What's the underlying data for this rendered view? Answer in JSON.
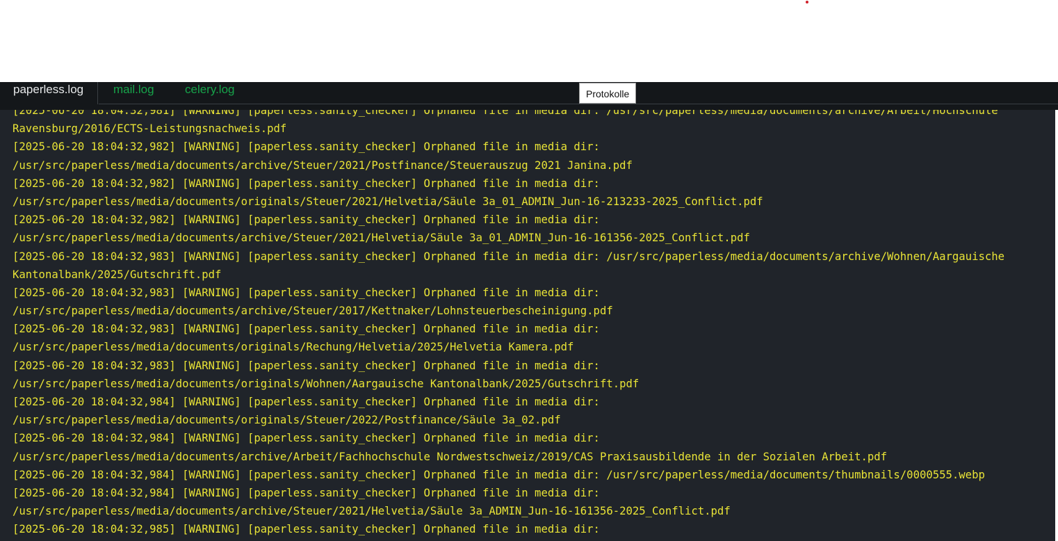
{
  "tabs": [
    {
      "label": "paperless.log",
      "active": true
    },
    {
      "label": "mail.log",
      "active": false
    },
    {
      "label": "celery.log",
      "active": false
    }
  ],
  "tooltip": "Protokolle",
  "colors": {
    "log_text": "#e8e336",
    "log_background": "#20242a",
    "tab_inactive": "#17a34a",
    "tab_bar": "#14171a"
  },
  "log_lines": [
    "[2025-06-20 18:04:32,981] [WARNING] [paperless.sanity_checker] Orphaned file in media dir: /usr/src/paperless/media/documents/archive/Arbeit/Hochschule",
    "Ravensburg/2016/ECTS-Leistungsnachweis.pdf",
    "[2025-06-20 18:04:32,982] [WARNING] [paperless.sanity_checker] Orphaned file in media dir:",
    "/usr/src/paperless/media/documents/archive/Steuer/2021/Postfinance/Steuerauszug 2021 Janina.pdf",
    "[2025-06-20 18:04:32,982] [WARNING] [paperless.sanity_checker] Orphaned file in media dir:",
    "/usr/src/paperless/media/documents/originals/Steuer/2021/Helvetia/Säule 3a_01_ADMIN_Jun-16-213233-2025_Conflict.pdf",
    "[2025-06-20 18:04:32,982] [WARNING] [paperless.sanity_checker] Orphaned file in media dir:",
    "/usr/src/paperless/media/documents/archive/Steuer/2021/Helvetia/Säule 3a_01_ADMIN_Jun-16-161356-2025_Conflict.pdf",
    "[2025-06-20 18:04:32,983] [WARNING] [paperless.sanity_checker] Orphaned file in media dir: /usr/src/paperless/media/documents/archive/Wohnen/Aargauische",
    "Kantonalbank/2025/Gutschrift.pdf",
    "[2025-06-20 18:04:32,983] [WARNING] [paperless.sanity_checker] Orphaned file in media dir:",
    "/usr/src/paperless/media/documents/archive/Steuer/2017/Kettnaker/Lohnsteuerbescheinigung.pdf",
    "[2025-06-20 18:04:32,983] [WARNING] [paperless.sanity_checker] Orphaned file in media dir:",
    "/usr/src/paperless/media/documents/originals/Rechung/Helvetia/2025/Helvetia Kamera.pdf",
    "[2025-06-20 18:04:32,983] [WARNING] [paperless.sanity_checker] Orphaned file in media dir:",
    "/usr/src/paperless/media/documents/originals/Wohnen/Aargauische Kantonalbank/2025/Gutschrift.pdf",
    "[2025-06-20 18:04:32,984] [WARNING] [paperless.sanity_checker] Orphaned file in media dir:",
    "/usr/src/paperless/media/documents/originals/Steuer/2022/Postfinance/Säule 3a_02.pdf",
    "[2025-06-20 18:04:32,984] [WARNING] [paperless.sanity_checker] Orphaned file in media dir:",
    "/usr/src/paperless/media/documents/archive/Arbeit/Fachhochschule Nordwestschweiz/2019/CAS Praxisausbildende in der Sozialen Arbeit.pdf",
    "[2025-06-20 18:04:32,984] [WARNING] [paperless.sanity_checker] Orphaned file in media dir: /usr/src/paperless/media/documents/thumbnails/0000555.webp",
    "[2025-06-20 18:04:32,984] [WARNING] [paperless.sanity_checker] Orphaned file in media dir:",
    "/usr/src/paperless/media/documents/archive/Steuer/2021/Helvetia/Säule 3a_ADMIN_Jun-16-161356-2025_Conflict.pdf",
    "[2025-06-20 18:04:32,985] [WARNING] [paperless.sanity_checker] Orphaned file in media dir:"
  ]
}
